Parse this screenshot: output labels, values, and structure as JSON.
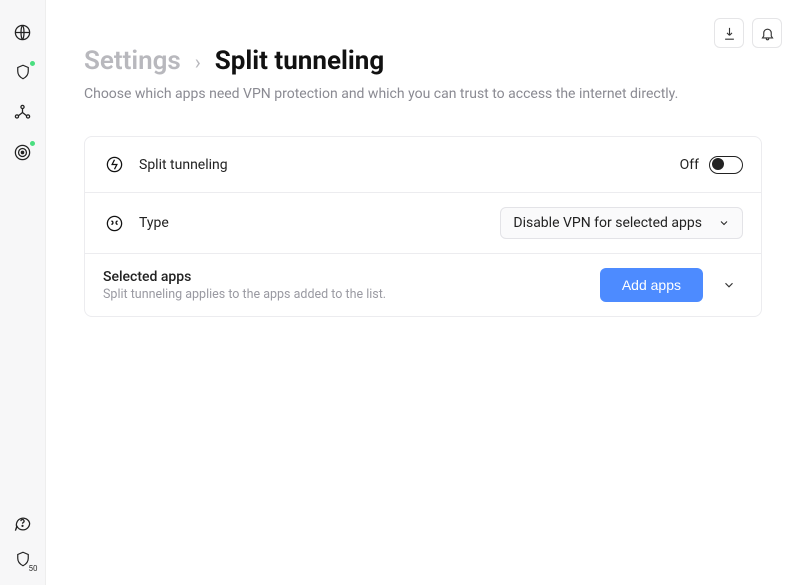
{
  "sidebar": {
    "items": [
      {
        "name": "globe-icon"
      },
      {
        "name": "shield-icon",
        "badge": true
      },
      {
        "name": "nodes-icon"
      },
      {
        "name": "radar-icon",
        "badge": true
      }
    ],
    "bottom": {
      "help": "help-icon",
      "dataShield": {
        "count": "50"
      }
    }
  },
  "topright": {
    "download": "download",
    "bell": "notifications"
  },
  "breadcrumb": {
    "parent": "Settings",
    "current": "Split tunneling"
  },
  "subtitle": "Choose which apps need VPN protection and which you can trust to access the internet directly.",
  "rows": {
    "splitTunneling": {
      "label": "Split tunneling",
      "stateLabel": "Off"
    },
    "type": {
      "label": "Type",
      "selected": "Disable VPN for selected apps"
    },
    "selectedApps": {
      "title": "Selected apps",
      "subtitle": "Split tunneling applies to the apps added to the list.",
      "button": "Add apps"
    }
  }
}
